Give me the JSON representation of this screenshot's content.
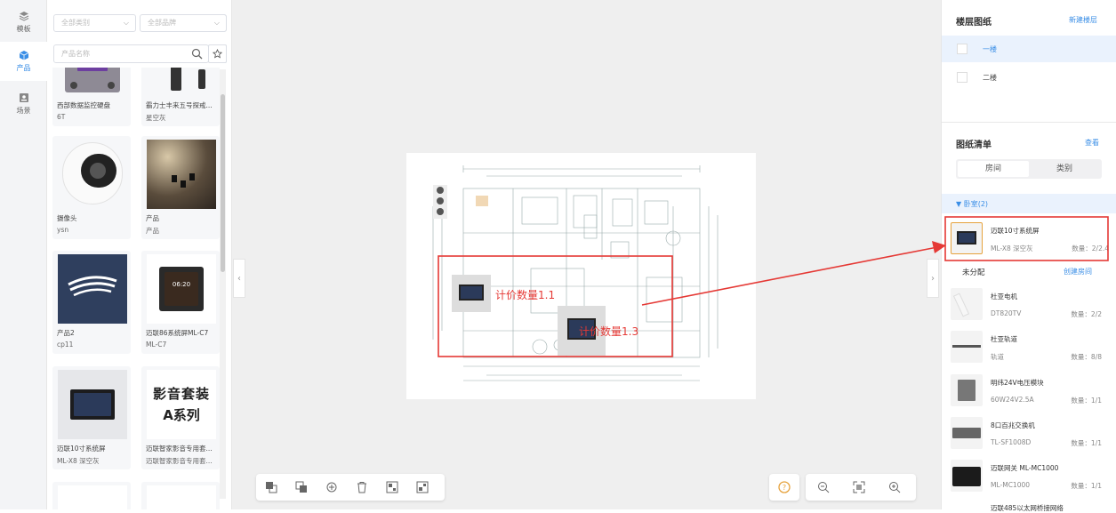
{
  "nav": {
    "items": [
      {
        "label": "模板",
        "icon": "layers-icon"
      },
      {
        "label": "产品",
        "icon": "cube-icon"
      },
      {
        "label": "场景",
        "icon": "scene-icon"
      }
    ]
  },
  "filters": {
    "category": "全部类别",
    "brand": "全部品牌",
    "search_placeholder": "产品名称"
  },
  "products": [
    {
      "name": "西部数据监控硬盘",
      "model": "6T"
    },
    {
      "name": "霸力士丰来五号探戒...",
      "model": "星空灰"
    },
    {
      "name": "摄像头",
      "model": "ysn"
    },
    {
      "name": "产品",
      "model": "产品"
    },
    {
      "name": "产品2",
      "model": "cp11"
    },
    {
      "name": "迈联86系统屏ML-C7",
      "model": "ML-C7"
    },
    {
      "name": "迈联10寸系统屏",
      "model": "ML-X8 深空灰"
    },
    {
      "name": "迈联智家影音专用套...",
      "model": "迈联智家影音专用套..."
    }
  ],
  "thumbs": {
    "av_line1": "影音套装",
    "av_line2": "A系列",
    "panel_time": "06:20"
  },
  "annotations": {
    "label1": "计价数量1.1",
    "label2": "计价数量1.3"
  },
  "right": {
    "floor_title": "楼层图纸",
    "new_floor": "新建楼层",
    "floors": [
      "一楼",
      "二楼"
    ],
    "list_title": "图纸清单",
    "view": "查看",
    "tabs": [
      "房间",
      "类别"
    ],
    "group": "▼ 卧室(2)",
    "selected_item": {
      "name": "迈联10寸系统屏",
      "model": "ML-X8 深空灰",
      "qty": "数量：2/2.4"
    },
    "unassigned": "未分配",
    "create_room": "创建房间",
    "items": [
      {
        "name": "杜亚电机",
        "model": "DT820TV",
        "qty": "数量：2/2",
        "icon": "motor-icon"
      },
      {
        "name": "杜亚轨道",
        "model": "轨道",
        "qty": "数量：8/8",
        "icon": "rail-icon"
      },
      {
        "name": "明纬24V电压模块",
        "model": "60W24V2.5A",
        "qty": "数量：1/1",
        "icon": "power-module-icon"
      },
      {
        "name": "8口百兆交换机",
        "model": "TL-SF1008D",
        "qty": "数量：1/1",
        "icon": "switch-icon"
      },
      {
        "name": "迈联网关 ML-MC1000",
        "model": "ML-MC1000",
        "qty": "数量：1/1",
        "icon": "gateway-icon"
      }
    ],
    "last_item": "迈联485以太网桥接网络"
  },
  "colors": {
    "accent": "#3a8ee6",
    "annotation": "#e53935",
    "canvas_bg": "#efefef",
    "selected_floor_bg": "#eaf2fd"
  }
}
